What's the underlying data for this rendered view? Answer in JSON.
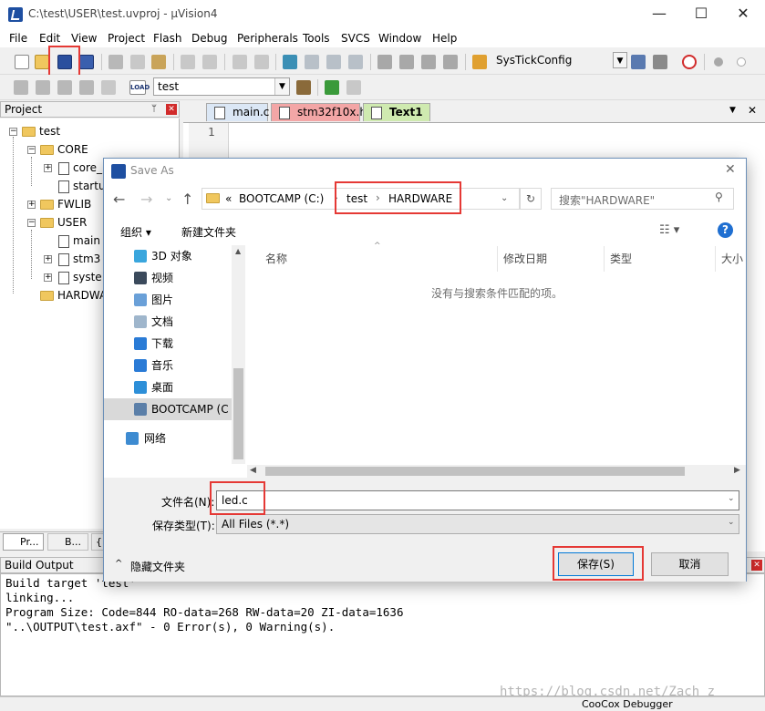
{
  "window": {
    "title": "C:\\test\\USER\\test.uvproj - µVision4",
    "minimize": "—",
    "maximize": "☐",
    "close": "✕"
  },
  "menu": [
    "File",
    "Edit",
    "View",
    "Project",
    "Flash",
    "Debug",
    "Peripherals",
    "Tools",
    "SVCS",
    "Window",
    "Help"
  ],
  "toolbar": {
    "function_combo": "SysTickConfig",
    "target_combo": "test",
    "load_label": "LOAD"
  },
  "project_panel": {
    "title": "Project",
    "root": "test",
    "groups": [
      {
        "name": "CORE",
        "files": [
          "core_",
          "startu"
        ]
      },
      {
        "name": "FWLIB",
        "files": []
      },
      {
        "name": "USER",
        "files": [
          "main",
          "stm3",
          "syste"
        ]
      },
      {
        "name": "HARDWA",
        "files": []
      }
    ],
    "bottom_tabs": [
      "Pr...",
      "B...",
      "{}"
    ]
  },
  "editor": {
    "tabs": [
      {
        "label": "main.c",
        "color": "#dbe7f5"
      },
      {
        "label": "stm32f10x.h",
        "color": "#f3a6a6"
      },
      {
        "label": "Text1",
        "color": "#cfeab0"
      }
    ],
    "line_number": "1"
  },
  "build_output": {
    "title": "Build Output",
    "lines": [
      "Build target 'test'",
      "linking...",
      "Program Size: Code=844 RO-data=268 RW-data=20 ZI-data=1636",
      "\"..\\OUTPUT\\test.axf\" - 0 Error(s), 0 Warning(s)."
    ]
  },
  "status_bar": {
    "debugger": "CooCox Debugger"
  },
  "watermark": "https://blog.csdn.net/Zach_z",
  "save_dialog": {
    "title": "Save As",
    "breadcrumb": {
      "prefix": "«",
      "drive": "BOOTCAMP (C:)",
      "path": [
        "test",
        "HARDWARE"
      ]
    },
    "search_placeholder": "搜索\"HARDWARE\"",
    "organize": "组织 ▾",
    "new_folder": "新建文件夹",
    "nav_items": [
      {
        "label": "3D 对象",
        "color": "#3aa6dd"
      },
      {
        "label": "视频",
        "color": "#3b4a5c"
      },
      {
        "label": "图片",
        "color": "#6aa0d8"
      },
      {
        "label": "文档",
        "color": "#9fb6cc"
      },
      {
        "label": "下载",
        "color": "#2a7bd6"
      },
      {
        "label": "音乐",
        "color": "#2a7bd6"
      },
      {
        "label": "桌面",
        "color": "#2d8fd8"
      },
      {
        "label": "BOOTCAMP (C",
        "color": "#5b7fa8"
      },
      {
        "label": "网络",
        "color": "#3d8bd1"
      }
    ],
    "columns": [
      "名称",
      "修改日期",
      "类型",
      "大小"
    ],
    "empty_message": "没有与搜索条件匹配的项。",
    "filename_label": "文件名(N):",
    "filename_value": "led.c",
    "filetype_label": "保存类型(T):",
    "filetype_value": "All Files (*.*)",
    "hide_folders": "隐藏文件夹",
    "save_button": "保存(S)",
    "cancel_button": "取消"
  }
}
